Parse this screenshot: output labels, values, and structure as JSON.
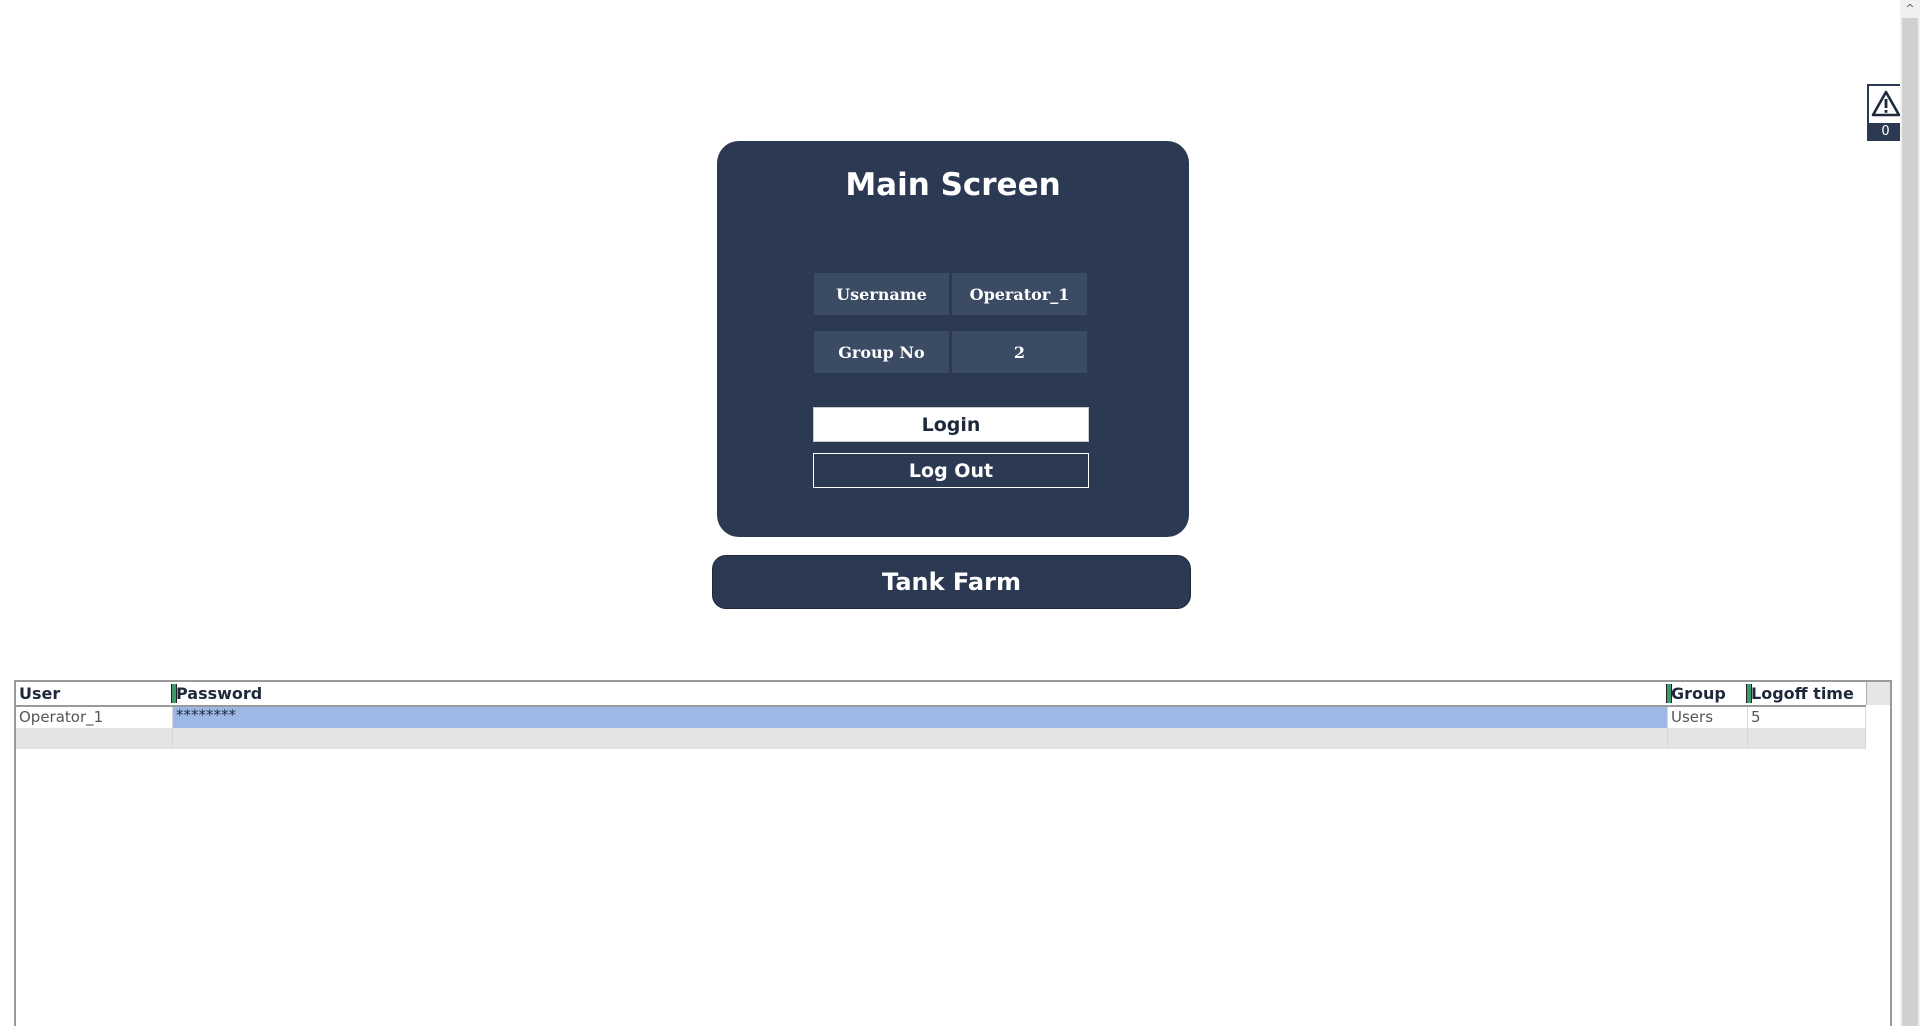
{
  "main_panel": {
    "title": "Main Screen",
    "username_label": "Username",
    "username_value": "Operator_1",
    "group_label": "Group No",
    "group_value": "2",
    "login_label": "Login",
    "logout_label": "Log Out"
  },
  "navigation": {
    "tank_farm_label": "Tank Farm"
  },
  "alarm": {
    "icon": "warning-triangle-icon",
    "count": "0"
  },
  "scrollbar": {
    "up_glyph": "^"
  },
  "user_table": {
    "columns": [
      "User",
      "Password",
      "Group",
      "Logoff time"
    ],
    "rows": [
      {
        "user": "Operator_1",
        "password": "********",
        "group": "Users",
        "logoff_time": "5"
      }
    ]
  },
  "colors": {
    "panel_bg": "#2b3a52",
    "cell_bg": "#3a4b63",
    "selected_cell": "#9db8e6",
    "empty_row": "#e4e4e4"
  }
}
